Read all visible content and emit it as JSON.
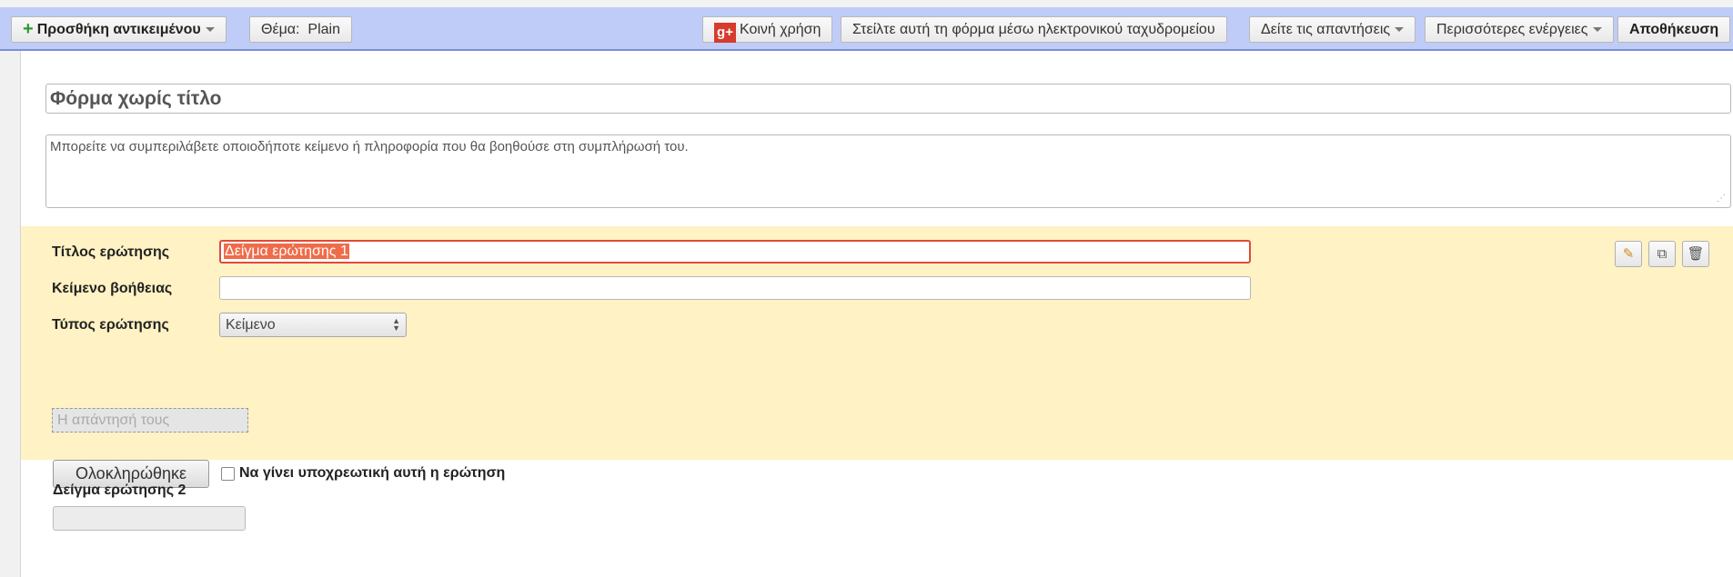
{
  "toolbar": {
    "add_item_label": "Προσθήκη αντικειμένου",
    "theme_prefix": "Θέμα:",
    "theme_value": "Plain",
    "share_label": "Κοινή χρήση",
    "email_form_label": "Στείλτε αυτή τη φόρμα μέσω ηλεκτρονικού ταχυδρομείου",
    "view_responses_label": "Δείτε τις απαντήσεις",
    "more_actions_label": "Περισσότερες ενέργειες",
    "save_label": "Αποθήκευση"
  },
  "form": {
    "title": "Φόρμα χωρίς τίτλο",
    "description": "Μπορείτε να συμπεριλάβετε οποιοδήποτε κείμενο ή πληροφορία που θα βοηθούσε στη συμπλήρωσή του."
  },
  "question_editor": {
    "title_label": "Τίτλος ερώτησης",
    "title_value": "Δείγμα ερώτησης 1",
    "help_label": "Κείμενο βοήθειας",
    "help_value": "",
    "type_label": "Τύπος ερώτησης",
    "type_value": "Κείμενο",
    "answer_placeholder": "Η απάντησή τους",
    "done_label": "Ολοκληρώθηκε",
    "required_label": "Να γίνει υποχρεωτική αυτή η ερώτηση",
    "required_checked": false
  },
  "question2": {
    "title": "Δείγμα ερώτησης 2"
  },
  "colors": {
    "toolbar_bg": "#bfccf8",
    "active_question_bg": "#fff2c4",
    "active_border": "#e04a3a",
    "selection": "#ef6c4a"
  },
  "icons": [
    "plus-icon",
    "google-plus-icon",
    "dropdown-caret-icon",
    "edit-pencil-icon",
    "duplicate-icon",
    "trash-icon",
    "resize-handle-icon"
  ]
}
